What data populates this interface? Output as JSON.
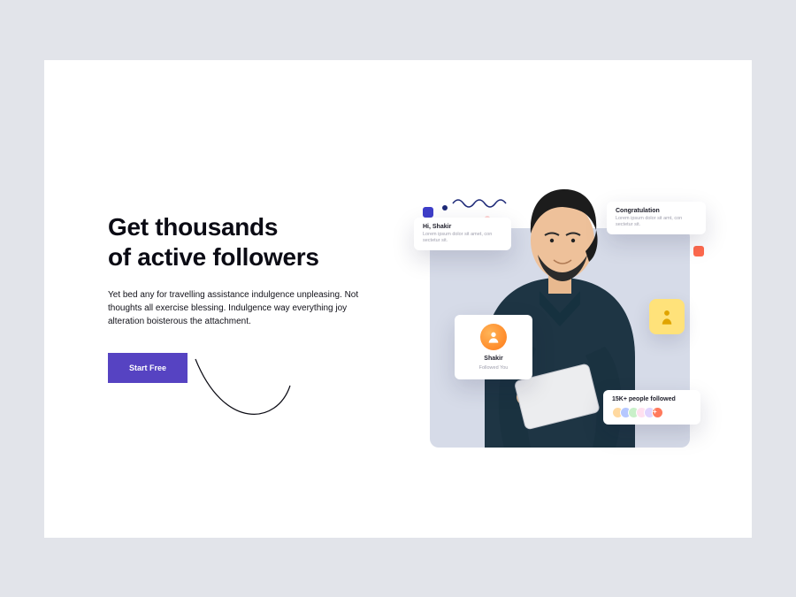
{
  "hero": {
    "title_line1": "Get thousands",
    "title_line2": "of active followers",
    "subtitle": "Yet bed any for travelling assistance indulgence unpleasing. Not thoughts all exercise blessing. Indulgence way everything joy alteration boisterous the attachment.",
    "cta_label": "Start Free"
  },
  "cards": {
    "hi": {
      "title": "Hi, Shakir",
      "text": "Lorem ipsum dolor sit amet, con sectetur sit."
    },
    "congrats": {
      "title": "Congratulation",
      "text": "Lorem ipsum dolor sit amt, con sectetur sit."
    },
    "follow": {
      "name": "Shakir",
      "sub": "Followed You"
    },
    "people": {
      "title": "15K+ people followed",
      "more": "+"
    }
  },
  "colors": {
    "accent": "#5643c2",
    "bg": "#e2e4ea"
  }
}
